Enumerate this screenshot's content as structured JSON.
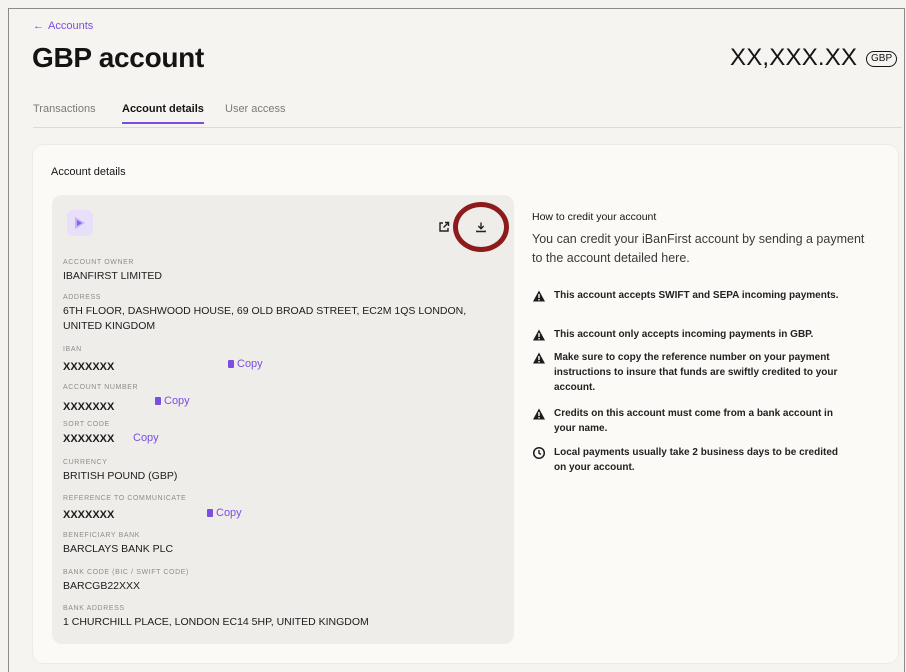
{
  "nav": {
    "back_label": "Accounts"
  },
  "page": {
    "title": "GBP account",
    "balance": "XX,XXX.XX",
    "currency_badge": "GBP"
  },
  "tabs": [
    {
      "label": "Transactions",
      "active": false
    },
    {
      "label": "Account details",
      "active": true
    },
    {
      "label": "User access",
      "active": false
    }
  ],
  "card": {
    "title": "Account details"
  },
  "details": {
    "owner_label": "ACCOUNT OWNER",
    "owner": "IBANFIRST LIMITED",
    "address_label": "ADDRESS",
    "address": "6TH FLOOR, DASHWOOD HOUSE, 69 OLD BROAD STREET, EC2M 1QS LONDON, UNITED KINGDOM",
    "iban_label": "IBAN",
    "iban": "XXXXXXX",
    "account_number_label": "ACCOUNT NUMBER",
    "account_number": "XXXXXXX",
    "sort_code_label": "SORT CODE",
    "sort_code": "XXXXXXX",
    "currency_label": "CURRENCY",
    "currency": "BRITISH POUND (GBP)",
    "reference_label": "REFERENCE TO COMMUNICATE",
    "reference": "XXXXXXX",
    "bank_label": "BENEFICIARY BANK",
    "bank": "BARCLAYS BANK PLC",
    "bic_label": "BANK CODE (BIC / SWIFT CODE)",
    "bic": "BARCGB22XXX",
    "bank_address_label": "BANK ADDRESS",
    "bank_address": "1 CHURCHILL PLACE, LONDON EC14 5HP, UNITED KINGDOM",
    "copy_label": "Copy"
  },
  "info": {
    "title": "How to credit your account",
    "body": "You can credit your iBanFirst account by sending a payment to the account detailed here.",
    "bullets": [
      {
        "icon": "warning-icon",
        "text": "This account accepts SWIFT and SEPA incoming payments."
      },
      {
        "icon": "warning-icon",
        "text": "This account only accepts incoming payments in GBP."
      },
      {
        "icon": "warning-icon",
        "text": "Make sure to copy the reference number on your payment instructions to insure that funds are swiftly credited to your account."
      },
      {
        "icon": "warning-icon",
        "text": "Credits on this account must come from a bank account in your name."
      },
      {
        "icon": "clock-icon",
        "text": "Local payments usually take 2 business days to be credited on your account."
      }
    ]
  },
  "colors": {
    "accent": "#7b4ee0",
    "highlight_ring": "#8e1b1b"
  }
}
